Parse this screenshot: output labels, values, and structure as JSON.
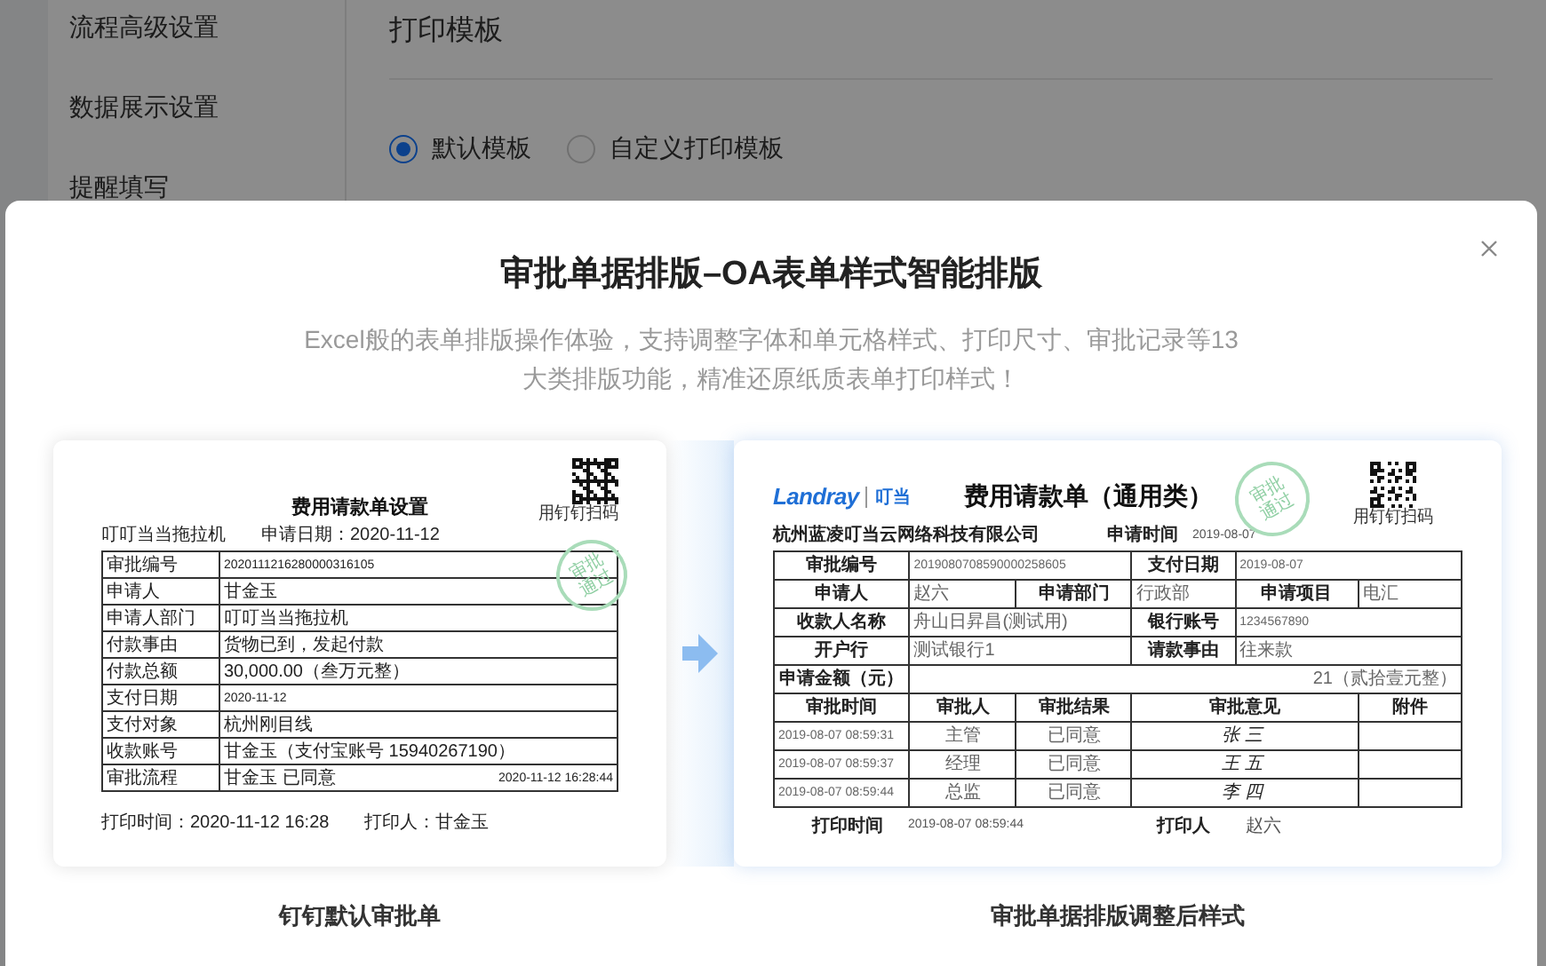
{
  "settings_page": {
    "sidebar": {
      "items": [
        {
          "label": "流程高级设置"
        },
        {
          "label": "数据展示设置"
        },
        {
          "label": "提醒填写"
        }
      ]
    },
    "section_title": "打印模板",
    "template_options": [
      {
        "label": "默认模板",
        "selected": true
      },
      {
        "label": "自定义打印模板",
        "selected": false
      }
    ]
  },
  "modal": {
    "title": "审批单据排版–OA表单样式智能排版",
    "description": "Excel般的表单排版操作体验，支持调整字体和单元格样式、打印尺寸、审批记录等13大类排版功能，精准还原纸质表单打印样式！",
    "default_form": {
      "title": "费用请款单设置",
      "org": "叮叮当当拖拉机",
      "apply_date": "申请日期：2020-11-12",
      "qr_caption": "用钉钉扫码",
      "stamp": "审批通过",
      "rows": [
        {
          "label": "审批编号",
          "value": "2020111216280000316105",
          "kind": "digits"
        },
        {
          "label": "申请人",
          "value": "甘金玉",
          "kind": "text"
        },
        {
          "label": "申请人部门",
          "value": "叮叮当当拖拉机",
          "kind": "text"
        },
        {
          "label": "付款事由",
          "value": "货物已到，发起付款",
          "kind": "text"
        },
        {
          "label": "付款总额",
          "value": "30,000.00（叁万元整）",
          "kind": "text"
        },
        {
          "label": "支付日期",
          "value": "2020-11-12",
          "kind": "digits"
        },
        {
          "label": "支付对象",
          "value": "杭州刚目线",
          "kind": "text"
        },
        {
          "label": "收款账号",
          "value": "甘金玉（支付宝账号 15940267190）",
          "kind": "text"
        },
        {
          "label": "审批流程",
          "value": "甘金玉 已同意",
          "time": "2020-11-12 16:28:44",
          "kind": "text"
        }
      ],
      "print_time": "打印时间：2020-11-12 16:28",
      "printer": "打印人：甘金玉",
      "caption": "钉钉默认审批单"
    },
    "custom_form": {
      "brand": "Landray",
      "brand_cn": "叮当",
      "title": "费用请款单（通用类）",
      "company": "杭州蓝凌叮当云网络科技有限公司",
      "apply_time_label": "申请时间",
      "apply_time": "2019-08-07",
      "qr_caption": "用钉钉扫码",
      "stamp": "审批通过",
      "rows": [
        [
          {
            "text": "审批编号",
            "kind": "label"
          },
          {
            "text": "2019080708590000258605",
            "kind": "digits",
            "colspan": 2
          },
          {
            "text": "支付日期",
            "kind": "label"
          },
          {
            "text": "2019-08-07",
            "kind": "digits",
            "colspan": 2
          }
        ],
        [
          {
            "text": "申请人",
            "kind": "label"
          },
          {
            "text": "赵六",
            "kind": "value"
          },
          {
            "text": "申请部门",
            "kind": "label"
          },
          {
            "text": "行政部",
            "kind": "value"
          },
          {
            "text": "申请项目",
            "kind": "label"
          },
          {
            "text": "电汇",
            "kind": "value"
          }
        ],
        [
          {
            "text": "收款人名称",
            "kind": "label"
          },
          {
            "text": "舟山日昇昌(测试用)",
            "kind": "value",
            "colspan": 2
          },
          {
            "text": "银行账号",
            "kind": "label"
          },
          {
            "text": "1234567890",
            "kind": "digits",
            "colspan": 2
          }
        ],
        [
          {
            "text": "开户行",
            "kind": "label"
          },
          {
            "text": "测试银行1",
            "kind": "value",
            "colspan": 2
          },
          {
            "text": "请款事由",
            "kind": "label"
          },
          {
            "text": "往来款",
            "kind": "value",
            "colspan": 2
          }
        ],
        [
          {
            "text": "申请金额（元）",
            "kind": "label"
          },
          {
            "text": "21（贰拾壹元整）",
            "kind": "amount",
            "colspan": 5
          }
        ],
        [
          {
            "text": "审批时间",
            "kind": "label"
          },
          {
            "text": "审批人",
            "kind": "label"
          },
          {
            "text": "审批结果",
            "kind": "label"
          },
          {
            "text": "审批意见",
            "kind": "label",
            "colspan": 2
          },
          {
            "text": "附件",
            "kind": "label"
          }
        ],
        [
          {
            "text": "2019-08-07 08:59:31",
            "kind": "digits"
          },
          {
            "text": "主管",
            "kind": "center"
          },
          {
            "text": "已同意",
            "kind": "center"
          },
          {
            "text": "张三",
            "kind": "signature",
            "colspan": 2
          },
          {
            "kind": "empty"
          }
        ],
        [
          {
            "text": "2019-08-07 08:59:37",
            "kind": "digits"
          },
          {
            "text": "经理",
            "kind": "center"
          },
          {
            "text": "已同意",
            "kind": "center"
          },
          {
            "text": "王五",
            "kind": "signature",
            "colspan": 2
          },
          {
            "kind": "empty"
          }
        ],
        [
          {
            "text": "2019-08-07 08:59:44",
            "kind": "digits"
          },
          {
            "text": "总监",
            "kind": "center"
          },
          {
            "text": "已同意",
            "kind": "center"
          },
          {
            "text": "李四",
            "kind": "signature",
            "colspan": 2
          },
          {
            "kind": "empty"
          }
        ]
      ],
      "print_time_label": "打印时间",
      "print_time": "2019-08-07 08:59:44",
      "printer_label": "打印人",
      "printer": "赵六",
      "caption": "审批单据排版调整后样式"
    }
  }
}
